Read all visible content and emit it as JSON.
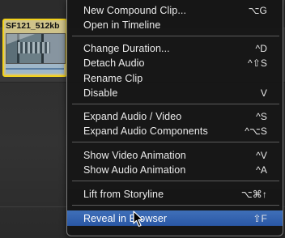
{
  "clip": {
    "title": "SF121_512kb"
  },
  "menu": {
    "groups": [
      [
        {
          "label": "New Compound Clip...",
          "shortcut": "⌥G"
        },
        {
          "label": "Open in Timeline",
          "shortcut": ""
        }
      ],
      [
        {
          "label": "Change Duration...",
          "shortcut": "^D"
        },
        {
          "label": "Detach Audio",
          "shortcut": "^⇧S"
        },
        {
          "label": "Rename Clip",
          "shortcut": ""
        },
        {
          "label": "Disable",
          "shortcut": "V"
        }
      ],
      [
        {
          "label": "Expand Audio / Video",
          "shortcut": "^S"
        },
        {
          "label": "Expand Audio Components",
          "shortcut": "^⌥S"
        }
      ],
      [
        {
          "label": "Show Video Animation",
          "shortcut": "^V"
        },
        {
          "label": "Show Audio Animation",
          "shortcut": "^A"
        }
      ],
      [
        {
          "label": "Lift from Storyline",
          "shortcut": "⌥⌘↑"
        }
      ],
      [
        {
          "label": "Reveal in Browser",
          "shortcut": "⇧F",
          "highlighted": true
        }
      ]
    ]
  }
}
